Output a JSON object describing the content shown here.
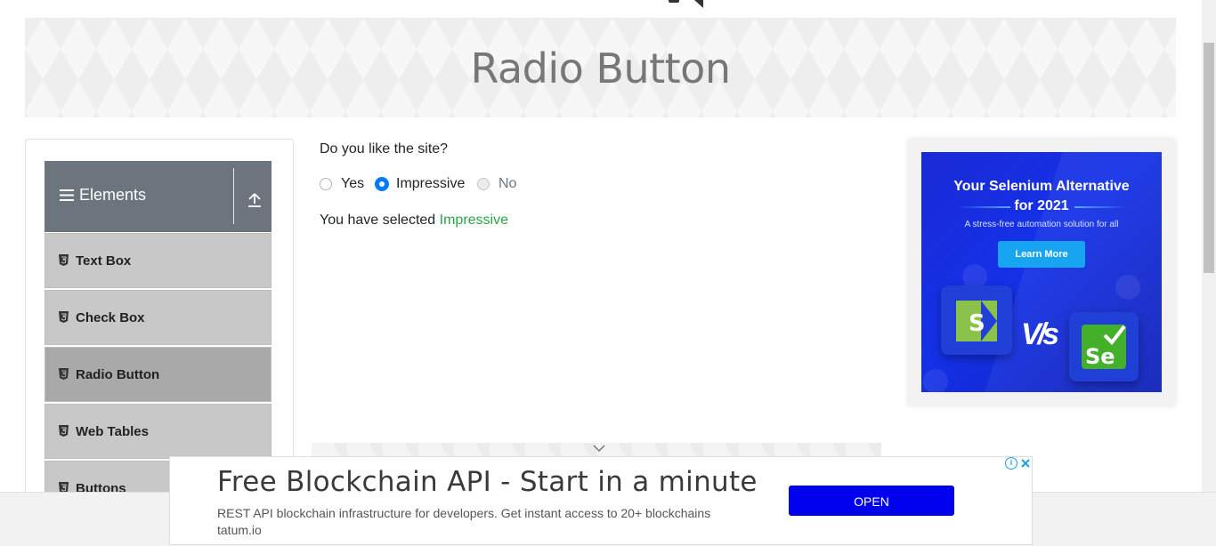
{
  "page": {
    "title": "Radio Button"
  },
  "sidebar": {
    "group_title": "Elements",
    "items": [
      {
        "label": "Text Box",
        "active": false
      },
      {
        "label": "Check Box",
        "active": false
      },
      {
        "label": "Radio Button",
        "active": true
      },
      {
        "label": "Web Tables",
        "active": false
      },
      {
        "label": "Buttons",
        "active": false
      }
    ]
  },
  "main": {
    "question": "Do you like the site?",
    "options": [
      {
        "label": "Yes",
        "checked": false,
        "disabled": false
      },
      {
        "label": "Impressive",
        "checked": true,
        "disabled": false
      },
      {
        "label": "No",
        "checked": false,
        "disabled": true
      }
    ],
    "result_prefix": "You have selected",
    "result_value": "Impressive"
  },
  "side_ad": {
    "headline_1": "Your Selenium Alternative",
    "headline_2": "for 2021",
    "subtitle": "A stress-free automation solution for all",
    "cta": "Learn More",
    "vs": "V/s",
    "left_logo": "S",
    "right_logo": "Se"
  },
  "bottom_ad": {
    "headline": "Free Blockchain API - Start in a minute",
    "body": "REST API blockchain infrastructure for developers. Get instant access to 20+ blockchains tatum.io",
    "cta": "OPEN",
    "adchoices_glyph": "i"
  },
  "colors": {
    "sidebar_header": "#6c757d",
    "menu_item": "#c8c8c8",
    "menu_item_active": "#a9a9a9",
    "radio_checked": "#007bff",
    "result_value": "#28a745",
    "open_button": "#0000ee",
    "ad_blue": "#1431e8"
  }
}
